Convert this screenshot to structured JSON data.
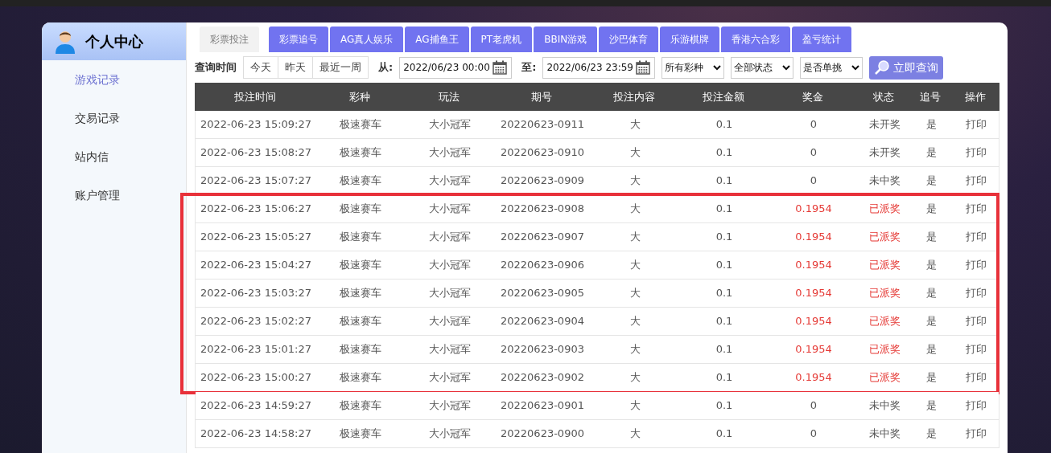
{
  "sidebar": {
    "title": "个人中心",
    "items": [
      {
        "label": "游戏记录",
        "selected": true
      },
      {
        "label": "交易记录",
        "selected": false
      },
      {
        "label": "站内信",
        "selected": false
      },
      {
        "label": "账户管理",
        "selected": false
      }
    ]
  },
  "tabs": [
    {
      "label": "彩票投注",
      "selected": true
    },
    {
      "label": "彩票追号",
      "selected": false
    },
    {
      "label": "AG真人娱乐",
      "selected": false
    },
    {
      "label": "AG捕鱼王",
      "selected": false
    },
    {
      "label": "PT老虎机",
      "selected": false
    },
    {
      "label": "BBIN游戏",
      "selected": false
    },
    {
      "label": "沙巴体育",
      "selected": false
    },
    {
      "label": "乐游棋牌",
      "selected": false
    },
    {
      "label": "香港六合彩",
      "selected": false
    },
    {
      "label": "盈亏统计",
      "selected": false
    }
  ],
  "filters": {
    "label": "查询时间",
    "quick": [
      "今天",
      "昨天",
      "最近一周"
    ],
    "from_label": "从:",
    "from": "2022/06/23 00:00",
    "to_label": "至:",
    "to": "2022/06/23 23:59",
    "selects": [
      "所有彩种",
      "全部状态",
      "是否单挑"
    ],
    "search_button": "立即查询"
  },
  "table": {
    "columns": [
      "投注时间",
      "彩种",
      "玩法",
      "期号",
      "投注内容",
      "投注金额",
      "奖金",
      "状态",
      "追号",
      "操作"
    ],
    "rows": [
      {
        "cells": [
          "2022-06-23 15:09:27",
          "极速赛车",
          "大小冠军",
          "20220623-0911",
          "大",
          "0.1",
          "0",
          "未开奖",
          "是",
          "打印"
        ],
        "won": false,
        "highlighted": false
      },
      {
        "cells": [
          "2022-06-23 15:08:27",
          "极速赛车",
          "大小冠军",
          "20220623-0910",
          "大",
          "0.1",
          "0",
          "未开奖",
          "是",
          "打印"
        ],
        "won": false,
        "highlighted": false
      },
      {
        "cells": [
          "2022-06-23 15:07:27",
          "极速赛车",
          "大小冠军",
          "20220623-0909",
          "大",
          "0.1",
          "0",
          "未中奖",
          "是",
          "打印"
        ],
        "won": false,
        "highlighted": false
      },
      {
        "cells": [
          "2022-06-23 15:06:27",
          "极速赛车",
          "大小冠军",
          "20220623-0908",
          "大",
          "0.1",
          "0.1954",
          "已派奖",
          "是",
          "打印"
        ],
        "won": true,
        "highlighted": true
      },
      {
        "cells": [
          "2022-06-23 15:05:27",
          "极速赛车",
          "大小冠军",
          "20220623-0907",
          "大",
          "0.1",
          "0.1954",
          "已派奖",
          "是",
          "打印"
        ],
        "won": true,
        "highlighted": true
      },
      {
        "cells": [
          "2022-06-23 15:04:27",
          "极速赛车",
          "大小冠军",
          "20220623-0906",
          "大",
          "0.1",
          "0.1954",
          "已派奖",
          "是",
          "打印"
        ],
        "won": true,
        "highlighted": true
      },
      {
        "cells": [
          "2022-06-23 15:03:27",
          "极速赛车",
          "大小冠军",
          "20220623-0905",
          "大",
          "0.1",
          "0.1954",
          "已派奖",
          "是",
          "打印"
        ],
        "won": true,
        "highlighted": true
      },
      {
        "cells": [
          "2022-06-23 15:02:27",
          "极速赛车",
          "大小冠军",
          "20220623-0904",
          "大",
          "0.1",
          "0.1954",
          "已派奖",
          "是",
          "打印"
        ],
        "won": true,
        "highlighted": true
      },
      {
        "cells": [
          "2022-06-23 15:01:27",
          "极速赛车",
          "大小冠军",
          "20220623-0903",
          "大",
          "0.1",
          "0.1954",
          "已派奖",
          "是",
          "打印"
        ],
        "won": true,
        "highlighted": true
      },
      {
        "cells": [
          "2022-06-23 15:00:27",
          "极速赛车",
          "大小冠军",
          "20220623-0902",
          "大",
          "0.1",
          "0.1954",
          "已派奖",
          "是",
          "打印"
        ],
        "won": true,
        "highlighted": true
      },
      {
        "cells": [
          "2022-06-23 14:59:27",
          "极速赛车",
          "大小冠军",
          "20220623-0901",
          "大",
          "0.1",
          "0",
          "未中奖",
          "是",
          "打印"
        ],
        "won": false,
        "highlighted": false
      },
      {
        "cells": [
          "2022-06-23 14:58:27",
          "极速赛车",
          "大小冠军",
          "20220623-0900",
          "大",
          "0.1",
          "0",
          "未中奖",
          "是",
          "打印"
        ],
        "won": false,
        "highlighted": false
      }
    ]
  }
}
